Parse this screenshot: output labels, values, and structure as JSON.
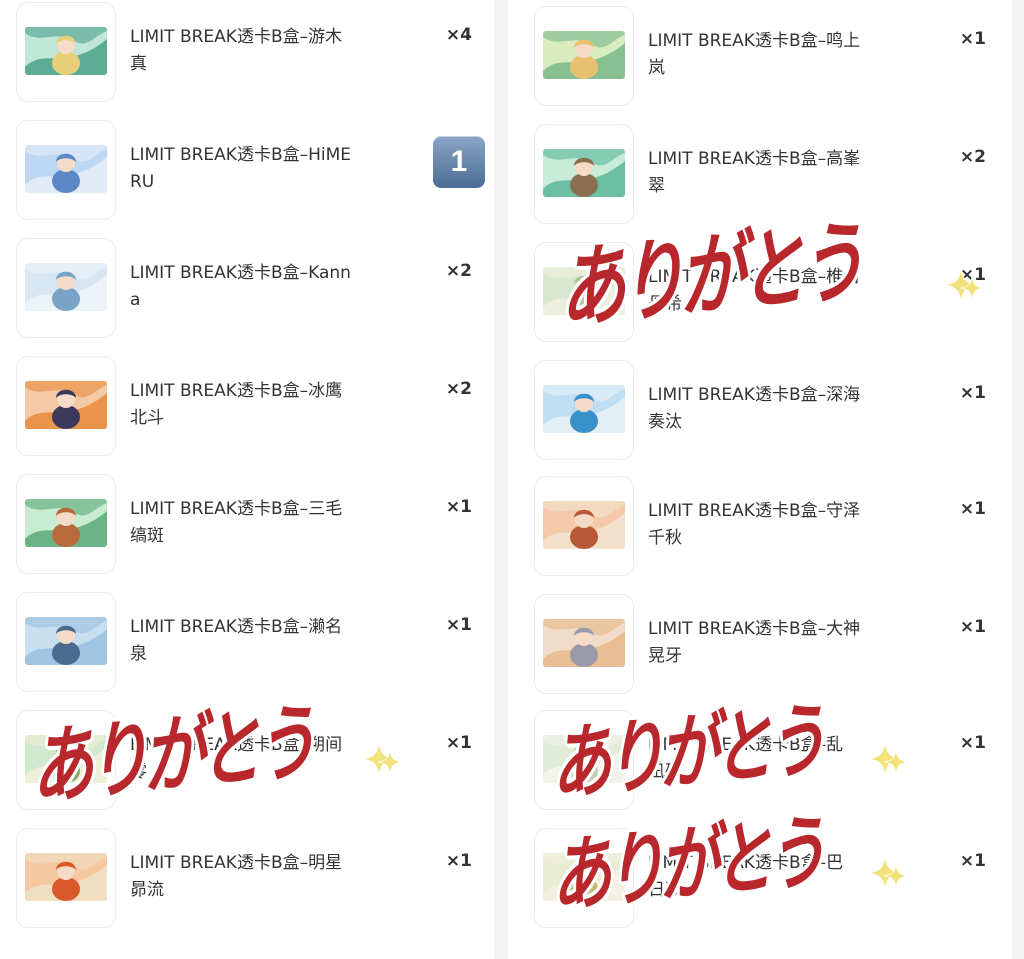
{
  "left_column": {
    "items": [
      {
        "title": "LIMIT BREAK透卡B盒–游木\n真",
        "qty": "×4",
        "palette": [
          "#bfe6d6",
          "#e8d07a",
          "#4aa08a"
        ]
      },
      {
        "title": "LIMIT BREAK透卡B盒–HiME\nRU",
        "qty": "",
        "palette": [
          "#bcd8f3",
          "#5c88c8",
          "#e8eef8"
        ]
      },
      {
        "title": "LIMIT BREAK透卡B盒–Kann\na",
        "qty": "×2",
        "palette": [
          "#d6e6f3",
          "#7aa3c8",
          "#f0f4f8"
        ]
      },
      {
        "title": "LIMIT BREAK透卡B盒–冰鹰\n北斗",
        "qty": "×2",
        "palette": [
          "#f3c9a6",
          "#3c3a5a",
          "#e88a3a"
        ]
      },
      {
        "title": "LIMIT BREAK透卡B盒–三毛\n缟斑",
        "qty": "×1",
        "palette": [
          "#c8ecd0",
          "#b86a3a",
          "#5aa87a"
        ]
      },
      {
        "title": "LIMIT BREAK透卡B盒–濑名\n泉",
        "qty": "×1",
        "palette": [
          "#c8dff0",
          "#4a6a90",
          "#9ac0e0"
        ]
      },
      {
        "title": "LIMIT BREAK透卡B盒–朔间\n零",
        "qty": "×1",
        "palette": [
          "#d0e8cc",
          "#8aa86a",
          "#f2f0d8"
        ]
      },
      {
        "title": "LIMIT BREAK透卡B盒–明星\n昴流",
        "qty": "×1",
        "palette": [
          "#f6c8a0",
          "#d85a2a",
          "#f0e0c8"
        ]
      }
    ]
  },
  "right_column": {
    "items": [
      {
        "title": "LIMIT BREAK透卡B盒–鸣上\n岚",
        "qty": "×1",
        "palette": [
          "#d8ecc0",
          "#e8c070",
          "#7ab88a"
        ]
      },
      {
        "title": "LIMIT BREAK透卡B盒–高峯\n翠",
        "qty": "×2",
        "palette": [
          "#c8ecd8",
          "#8a7050",
          "#5ab89a"
        ]
      },
      {
        "title": "LIMIT BREAK透卡B盒–椎名\n丹希",
        "qty": "×1",
        "palette": [
          "#d8e8d0",
          "#a8c890",
          "#f0f0e0"
        ]
      },
      {
        "title": "LIMIT BREAK透卡B盒–深海\n奏汰",
        "qty": "×1",
        "palette": [
          "#c0def2",
          "#3a90c8",
          "#e8f2f8"
        ]
      },
      {
        "title": "LIMIT BREAK透卡B盒–守泽\n千秋",
        "qty": "×1",
        "palette": [
          "#f4c8a8",
          "#b85a3a",
          "#f2e4d0"
        ]
      },
      {
        "title": "LIMIT BREAK透卡B盒–大神\n晃牙",
        "qty": "×1",
        "palette": [
          "#f0dcc8",
          "#9a9aa8",
          "#e8b88a"
        ]
      },
      {
        "title": "LIMIT BREAK透卡B盒–乱\n凪砂",
        "qty": "×1",
        "palette": [
          "#e0ecd8",
          "#c8d0b0",
          "#f4f4ec"
        ]
      },
      {
        "title": "LIMIT BREAK透卡B盒–巴\n日和",
        "qty": "×1",
        "palette": [
          "#e8ecd0",
          "#c8b878",
          "#f4f2e4"
        ]
      }
    ]
  },
  "badge": {
    "label": "1"
  },
  "stickers": {
    "text": "ありがとう",
    "color": "#b8272c",
    "sparkle_color": "#f3e27a"
  }
}
